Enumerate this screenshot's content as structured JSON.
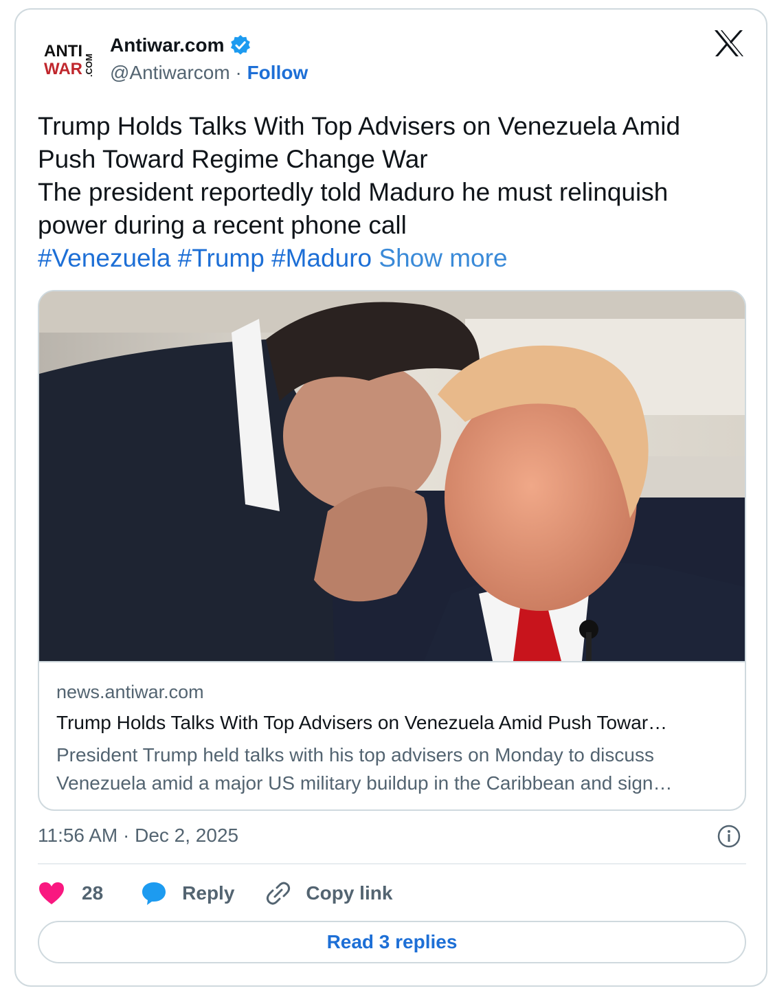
{
  "author": {
    "logo_text": [
      "ANTI",
      "WAR",
      ".COM"
    ],
    "name": "Antiwar.com",
    "verified": true,
    "handle": "@Antiwarcom",
    "separator": "·",
    "follow_label": "Follow"
  },
  "platform_icon": "x-logo-icon",
  "post": {
    "lines": [
      "Trump Holds Talks With Top Advisers on Venezuela Amid",
      "Push Toward Regime Change War",
      "The president reportedly told Maduro he must relinquish",
      "power during a recent phone call"
    ],
    "hashtags": [
      "#Venezuela",
      "#Trump",
      "#Maduro"
    ],
    "show_more": "Show more"
  },
  "link_card": {
    "domain": "news.antiwar.com",
    "title": "Trump Holds Talks With Top Advisers on Venezuela Amid Push Towar…",
    "description": [
      "President Trump held talks with his top advisers on Monday to discuss",
      "Venezuela amid a major US military buildup in the Caribbean and sign…"
    ]
  },
  "timestamp": "11:56 AM · Dec 2, 2025",
  "actions": {
    "like_count": "28",
    "reply_label": "Reply",
    "copy_label": "Copy link"
  },
  "read_replies_label": "Read 3 replies",
  "colors": {
    "accent": "#1d6fd6",
    "like": "#f91880",
    "secondary_text": "#536471",
    "border": "#cfd9de"
  }
}
